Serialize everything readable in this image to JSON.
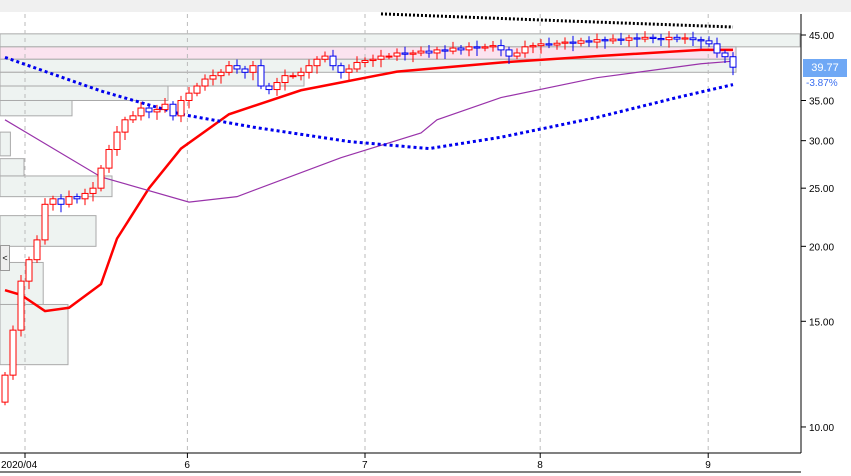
{
  "chart_data": {
    "type": "candlestick",
    "title": "",
    "scale": "log",
    "ylim": [
      9.5,
      50
    ],
    "y_ticks": [
      "45.00",
      "35.00",
      "30.00",
      "25.00",
      "20.00",
      "15.00",
      "10.00"
    ],
    "y_tick_values": [
      45,
      35,
      30,
      25,
      20,
      15,
      10
    ],
    "x_ticks": [
      {
        "label": "2020/04",
        "index": 2.5
      },
      {
        "label": "6",
        "index": 22.8
      },
      {
        "label": "7",
        "index": 45
      },
      {
        "label": "8",
        "index": 66.9
      },
      {
        "label": "9",
        "index": 87.9
      }
    ],
    "first_open": 11.0,
    "close": [
      12.2,
      14.5,
      17.5,
      19.0,
      20.5,
      23.5,
      24.0,
      23.5,
      24.2,
      24.0,
      24.5,
      25.0,
      27,
      29,
      31,
      32.5,
      33,
      34,
      33.5,
      33.8,
      34.5,
      33,
      35,
      36,
      37,
      38,
      38.5,
      39,
      40,
      39.5,
      39,
      40,
      37,
      36.5,
      37.5,
      38.5,
      38.5,
      39,
      40,
      41,
      41.5,
      40,
      39,
      39.5,
      40.5,
      40.8,
      41,
      41.5,
      41.5,
      42,
      41.8,
      42,
      42.3,
      42,
      42.5,
      42.3,
      42.8,
      42.5,
      43,
      42.8,
      43,
      43.2,
      42.5,
      41.5,
      42,
      43,
      43.2,
      43.5,
      43.3,
      43.6,
      43.8,
      43.6,
      44,
      43.8,
      44.2,
      44,
      44.3,
      44.1,
      44.5,
      44.3,
      44.6,
      44.4,
      44.2,
      44.6,
      44.3,
      44.5,
      44.2,
      44.0,
      43.5,
      42.0,
      41.4,
      39.77
    ],
    "series": [
      {
        "name": "ma-red",
        "color": "#ff0000",
        "style": "solid",
        "points": [
          [
            0,
            16.9
          ],
          [
            2,
            16.6
          ],
          [
            5,
            15.6
          ],
          [
            8,
            15.8
          ],
          [
            12,
            17.3
          ],
          [
            14,
            20.6
          ],
          [
            18,
            25.0
          ],
          [
            22,
            29.1
          ],
          [
            28,
            33.2
          ],
          [
            37,
            36.4
          ],
          [
            49,
            39.1
          ],
          [
            62,
            40.5
          ],
          [
            74,
            41.5
          ],
          [
            87,
            42.5
          ],
          [
            91,
            42.5
          ]
        ]
      },
      {
        "name": "ma-purple",
        "color": "#9933aa",
        "style": "solid",
        "points": [
          [
            0,
            32.5
          ],
          [
            12,
            26.1
          ],
          [
            23,
            23.7
          ],
          [
            29,
            24.2
          ],
          [
            42,
            28.1
          ],
          [
            52,
            30.9
          ],
          [
            54,
            32.5
          ],
          [
            62,
            35.4
          ],
          [
            74,
            38.2
          ],
          [
            87,
            40.3
          ],
          [
            91,
            40.7
          ]
        ]
      },
      {
        "name": "ma-blue-dotted",
        "color": "#0000ee",
        "style": "dotted",
        "points": [
          [
            0,
            41.3
          ],
          [
            12,
            36.3
          ],
          [
            22,
            33.2
          ],
          [
            31,
            31.6
          ],
          [
            43,
            29.9
          ],
          [
            53,
            29.1
          ],
          [
            62,
            30.4
          ],
          [
            74,
            32.8
          ],
          [
            84,
            35.4
          ],
          [
            91,
            37.2
          ]
        ]
      },
      {
        "name": "ma-black-dotted",
        "color": "#000000",
        "style": "dotted",
        "points": [
          [
            47,
            48.8
          ],
          [
            70,
            47.5
          ],
          [
            91,
            46.4
          ]
        ]
      }
    ],
    "volume_profile": [
      {
        "low": 43.0,
        "high": 45.2,
        "relative": 100
      },
      {
        "low": 41.0,
        "high": 43.0,
        "relative": 92,
        "highlight": true
      },
      {
        "low": 39.0,
        "high": 41.0,
        "relative": 92
      },
      {
        "low": 37.0,
        "high": 39.0,
        "relative": 38
      },
      {
        "low": 35.0,
        "high": 37.0,
        "relative": 21
      },
      {
        "low": 33.0,
        "high": 35.0,
        "relative": 9
      },
      {
        "low": 28.3,
        "high": 31.0,
        "relative": 1.3
      },
      {
        "low": 26.2,
        "high": 28.0,
        "relative": 3
      },
      {
        "low": 24.2,
        "high": 26.2,
        "relative": 14
      },
      {
        "low": 20.0,
        "high": 22.5,
        "relative": 12
      },
      {
        "low": 16.0,
        "high": 18.8,
        "relative": 5.4
      },
      {
        "low": 12.7,
        "high": 16.0,
        "relative": 8.5
      }
    ],
    "last_price": "39.77",
    "change_pct": "-3.87%",
    "colors": {
      "up": "#ff0000",
      "down": "#0000ee",
      "price_box": "#6fa8f5"
    }
  }
}
